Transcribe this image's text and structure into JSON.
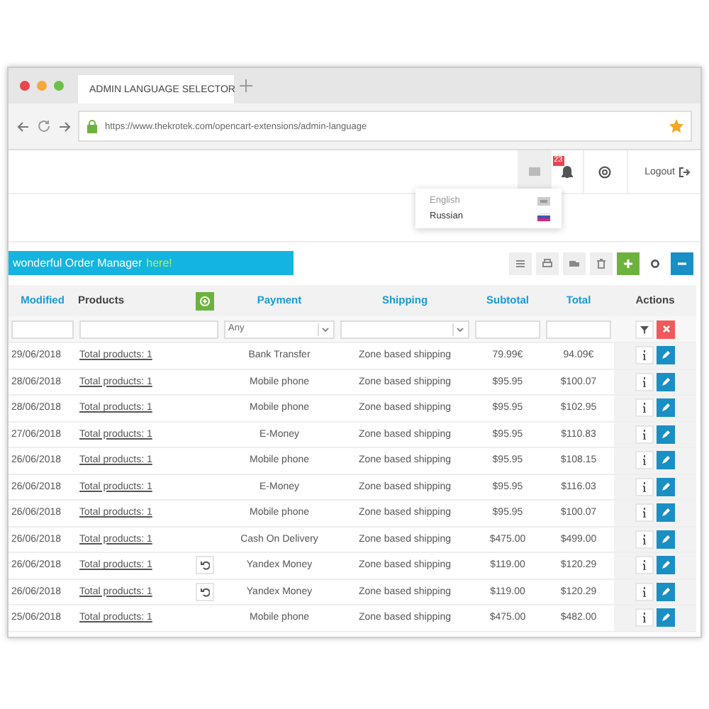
{
  "browser": {
    "tab_title": "ADMIN LANGUAGE SELECTOR",
    "url": "https://www.thekrotek.com/opencart-extensions/admin-language"
  },
  "header": {
    "notification_count": "23",
    "logout": "Logout"
  },
  "language_menu": [
    {
      "label": "English",
      "selected": false
    },
    {
      "label": "Russian",
      "selected": true
    }
  ],
  "banner": {
    "text": "wonderful Order Manager",
    "link": "here!"
  },
  "table": {
    "columns": [
      {
        "label": "Modified",
        "sortable": true
      },
      {
        "label": "Products",
        "sortable": false
      },
      {
        "label": "Payment",
        "sortable": true
      },
      {
        "label": "Shipping",
        "sortable": true
      },
      {
        "label": "Subtotal",
        "sortable": true
      },
      {
        "label": "Total",
        "sortable": true
      },
      {
        "label": "Actions",
        "sortable": false
      }
    ],
    "payment_filter": "Any",
    "rows": [
      {
        "date": "29/06/2018",
        "products": "Total products: 1",
        "returned": false,
        "payment": "Bank Transfer",
        "shipping": "Zone based shipping",
        "subtotal": "79.99€",
        "total": "94.09€"
      },
      {
        "date": "28/06/2018",
        "products": "Total products: 1",
        "returned": false,
        "payment": "Mobile phone",
        "shipping": "Zone based shipping",
        "subtotal": "$95.95",
        "total": "$100.07"
      },
      {
        "date": "28/06/2018",
        "products": "Total products: 1",
        "returned": false,
        "payment": "Mobile phone",
        "shipping": "Zone based shipping",
        "subtotal": "$95.95",
        "total": "$102.95"
      },
      {
        "date": "27/06/2018",
        "products": "Total products: 1",
        "returned": false,
        "payment": "E-Money",
        "shipping": "Zone based shipping",
        "subtotal": "$95.95",
        "total": "$110.83"
      },
      {
        "date": "26/06/2018",
        "products": "Total products: 1",
        "returned": false,
        "payment": "Mobile phone",
        "shipping": "Zone based shipping",
        "subtotal": "$95.95",
        "total": "$108.15"
      },
      {
        "date": "26/06/2018",
        "products": "Total products: 1",
        "returned": false,
        "payment": "E-Money",
        "shipping": "Zone based shipping",
        "subtotal": "$95.95",
        "total": "$116.03"
      },
      {
        "date": "26/06/2018",
        "products": "Total products: 1",
        "returned": false,
        "payment": "Mobile phone",
        "shipping": "Zone based shipping",
        "subtotal": "$95.95",
        "total": "$100.07"
      },
      {
        "date": "26/06/2018",
        "products": "Total products: 1",
        "returned": false,
        "payment": "Cash On Delivery",
        "shipping": "Zone based shipping",
        "subtotal": "$475.00",
        "total": "$499.00"
      },
      {
        "date": "26/06/2018",
        "products": "Total products: 1",
        "returned": true,
        "payment": "Yandex Money",
        "shipping": "Zone based shipping",
        "subtotal": "$119.00",
        "total": "$120.29"
      },
      {
        "date": "26/06/2018",
        "products": "Total products: 1",
        "returned": true,
        "payment": "Yandex Money",
        "shipping": "Zone based shipping",
        "subtotal": "$119.00",
        "total": "$120.29"
      },
      {
        "date": "25/06/2018",
        "products": "Total products: 1",
        "returned": false,
        "payment": "Mobile phone",
        "shipping": "Zone based shipping",
        "subtotal": "$475.00",
        "total": "$482.00"
      }
    ]
  }
}
